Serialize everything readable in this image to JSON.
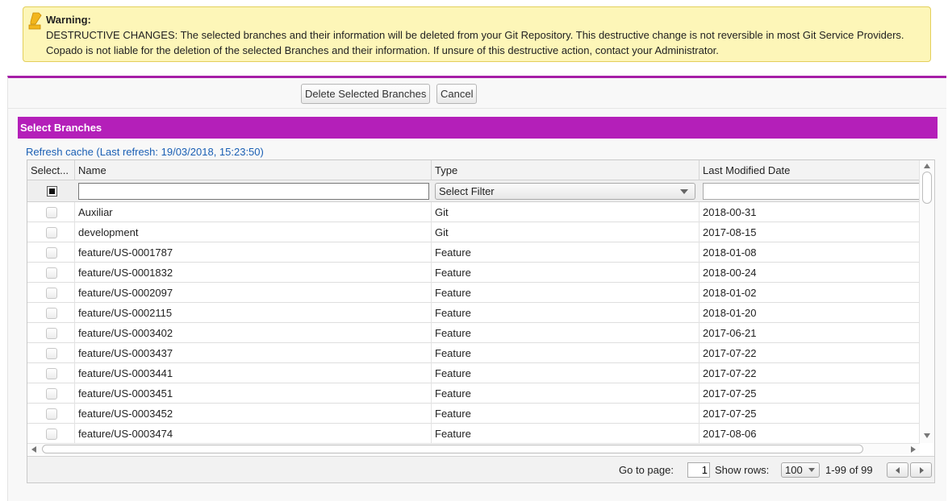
{
  "warning": {
    "icon": "warning-pencil-icon",
    "title": "Warning:",
    "message": "DESTRUCTIVE CHANGES: The selected branches and their information will be deleted from your Git Repository. This destructive change is not reversible in most Git Service Providers. Copado is not liable for the deletion of the selected Branches and their information. If unsure of this destructive action, contact your Administrator."
  },
  "toolbar": {
    "delete_label": "Delete Selected Branches",
    "cancel_label": "Cancel"
  },
  "section": {
    "title": "Select Branches",
    "refresh_link": "Refresh cache (Last refresh: 19/03/2018, 15:23:50)"
  },
  "grid": {
    "columns": {
      "select": "Select...",
      "name": "Name",
      "type": "Type",
      "last_modified": "Last Modified Date"
    },
    "filters": {
      "name_value": "",
      "type_value": "Select Filter",
      "date_value": ""
    },
    "rows": [
      {
        "name": "Auxiliar",
        "type": "Git",
        "date": "2018-00-31"
      },
      {
        "name": "development",
        "type": "Git",
        "date": "2017-08-15"
      },
      {
        "name": "feature/US-0001787",
        "type": "Feature",
        "date": "2018-01-08"
      },
      {
        "name": "feature/US-0001832",
        "type": "Feature",
        "date": "2018-00-24"
      },
      {
        "name": "feature/US-0002097",
        "type": "Feature",
        "date": "2018-01-02"
      },
      {
        "name": "feature/US-0002115",
        "type": "Feature",
        "date": "2018-01-20"
      },
      {
        "name": "feature/US-0003402",
        "type": "Feature",
        "date": "2017-06-21"
      },
      {
        "name": "feature/US-0003437",
        "type": "Feature",
        "date": "2017-07-22"
      },
      {
        "name": "feature/US-0003441",
        "type": "Feature",
        "date": "2017-07-22"
      },
      {
        "name": "feature/US-0003451",
        "type": "Feature",
        "date": "2017-07-25"
      },
      {
        "name": "feature/US-0003452",
        "type": "Feature",
        "date": "2017-07-25"
      },
      {
        "name": "feature/US-0003474",
        "type": "Feature",
        "date": "2017-08-06"
      }
    ]
  },
  "pager": {
    "go_to_label": "Go to page:",
    "page_value": "1",
    "show_rows_label": "Show rows:",
    "rows_value": "100",
    "range_text": "1-99 of 99"
  },
  "colors": {
    "accent": "#b41fb9",
    "warning_bg": "#fdf6b8",
    "link": "#1a5fb4"
  }
}
